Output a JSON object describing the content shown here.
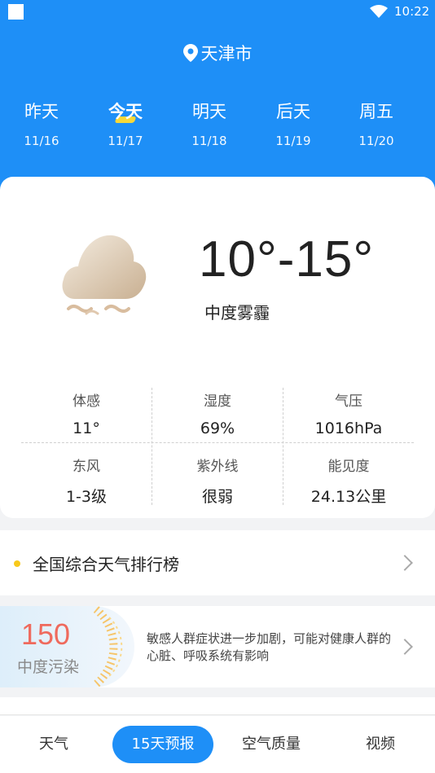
{
  "status_bar": {
    "time": "10:22"
  },
  "location": {
    "city": "天津市"
  },
  "day_tabs": [
    {
      "name": "昨天",
      "date": "11/16"
    },
    {
      "name": "今天",
      "date": "11/17"
    },
    {
      "name": "明天",
      "date": "11/18"
    },
    {
      "name": "后天",
      "date": "11/19"
    },
    {
      "name": "周五",
      "date": "11/20"
    }
  ],
  "current": {
    "temp_range": "10°-15°",
    "condition": "中度雾霾",
    "icon": "haze-cloud-icon"
  },
  "details": [
    {
      "label": "体感",
      "value": "11°"
    },
    {
      "label": "湿度",
      "value": "69%"
    },
    {
      "label": "气压",
      "value": "1016hPa"
    },
    {
      "label": "东风",
      "value": "1-3级"
    },
    {
      "label": "紫外线",
      "value": "很弱"
    },
    {
      "label": "能见度",
      "value": "24.13公里"
    }
  ],
  "ranking": {
    "title": "全国综合天气排行榜"
  },
  "air_quality": {
    "aqi": "150",
    "level": "中度污染",
    "advice": "敏感人群症状进一步加剧，可能对健康人群的心脏、呼吸系统有影响"
  },
  "bottom_tabs": [
    {
      "label": "天气"
    },
    {
      "label": "15天预报"
    },
    {
      "label": "空气质量"
    },
    {
      "label": "视频"
    }
  ],
  "colors": {
    "primary": "#1e8ff7",
    "highlight": "#f7d838",
    "aqi": "#ef6a5d"
  }
}
